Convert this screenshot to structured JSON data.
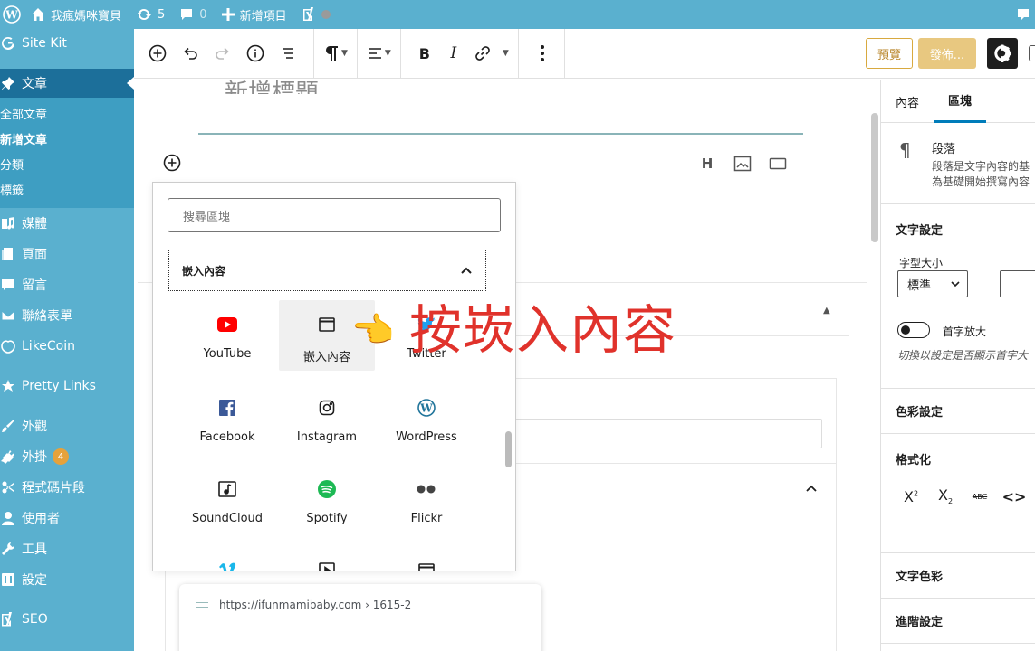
{
  "admin_bar": {
    "site_name": "我瘋媽咪寶貝",
    "updates_count": "5",
    "comments_count": "0",
    "new_item_label": "新增項目"
  },
  "sidebar": {
    "site_kit": "Site Kit",
    "posts": "文章",
    "submenu": [
      "全部文章",
      "新增文章",
      "分類",
      "標籤"
    ],
    "media": "媒體",
    "pages": "頁面",
    "comments": "留言",
    "contact": "聯絡表單",
    "likecoin": "LikeCoin",
    "pretty_links": "Pretty Links",
    "appearance": "外觀",
    "plugins": "外掛",
    "plugins_badge": "4",
    "snippets": "程式碼片段",
    "users": "使用者",
    "tools": "工具",
    "settings": "設定",
    "seo": "SEO"
  },
  "toolbar": {
    "preview": "預覽",
    "publish": "發佈..."
  },
  "canvas": {
    "title_placeholder": "新增標題",
    "snippet_url": "https://ifunmamibaby.com › 1615-2"
  },
  "inserter": {
    "search_placeholder": "搜尋區塊",
    "panel_title": "嵌入內容",
    "blocks": [
      {
        "label": "YouTube"
      },
      {
        "label": "嵌入內容"
      },
      {
        "label": "Twitter"
      },
      {
        "label": "Facebook"
      },
      {
        "label": "Instagram"
      },
      {
        "label": "WordPress"
      },
      {
        "label": "SoundCloud"
      },
      {
        "label": "Spotify"
      },
      {
        "label": "Flickr"
      }
    ]
  },
  "annotation": {
    "text": "按崁入內容"
  },
  "settings_panel": {
    "tab_document": "內容",
    "tab_block": "區塊",
    "block_name": "段落",
    "block_desc_1": "段落是文字內容的基",
    "block_desc_2": "為基礎開始撰寫內容",
    "typography_title": "文字設定",
    "font_size_label": "字型大小",
    "font_size_value": "標準",
    "dropcap_label": "首字放大",
    "dropcap_help": "切換以設定是否顯示首字大",
    "color_settings": "色彩設定",
    "formatting": "格式化",
    "text_color": "文字色彩",
    "advanced": "進階設定"
  },
  "colors": {
    "admin_blue": "#5ab0cf",
    "active_menu": "#1c6f9a",
    "preview_border": "#d8a93f",
    "publish_bg": "#e8c880",
    "annotation_red": "#e0322b",
    "tab_accent": "#007cba"
  }
}
